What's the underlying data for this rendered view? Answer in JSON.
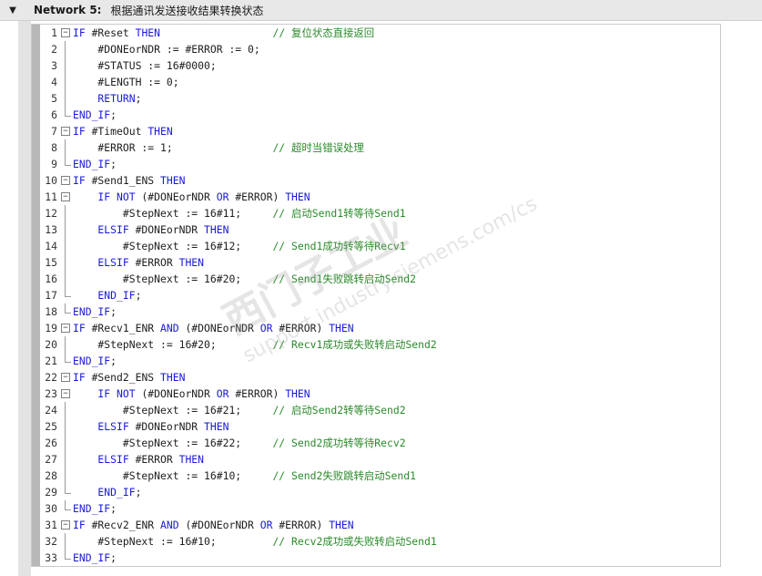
{
  "network": {
    "title": "Network 5:",
    "comment": "根据通讯发送接收结果转换状态",
    "toggle_icon": "▼"
  },
  "watermark": {
    "line1": "西门子工业",
    "line2": "support.industry.siemens.com/cs"
  },
  "code_lines": [
    {
      "n": "1",
      "fold": "open",
      "tokens": [
        [
          "kw",
          "IF "
        ],
        [
          "var",
          "#Reset "
        ],
        [
          "kw",
          "THEN"
        ],
        [
          "var",
          "                  "
        ],
        [
          "cm",
          "// 复位状态直接返回"
        ]
      ]
    },
    {
      "n": "2",
      "fold": "mid",
      "tokens": [
        [
          "var",
          "    #DONEorNDR := #ERROR := 0;"
        ]
      ]
    },
    {
      "n": "3",
      "fold": "mid",
      "tokens": [
        [
          "var",
          "    #STATUS := 16#0000;"
        ]
      ]
    },
    {
      "n": "4",
      "fold": "mid",
      "tokens": [
        [
          "var",
          "    #LENGTH := 0;"
        ]
      ]
    },
    {
      "n": "5",
      "fold": "mid",
      "tokens": [
        [
          "kw",
          "    RETURN"
        ],
        [
          "var",
          ";"
        ]
      ]
    },
    {
      "n": "6",
      "fold": "end",
      "tokens": [
        [
          "kw",
          "END_IF"
        ],
        [
          "var",
          ";"
        ]
      ]
    },
    {
      "n": "7",
      "fold": "open",
      "tokens": [
        [
          "kw",
          "IF "
        ],
        [
          "var",
          "#TimeOut "
        ],
        [
          "kw",
          "THEN"
        ]
      ]
    },
    {
      "n": "8",
      "fold": "mid",
      "tokens": [
        [
          "var",
          "    #ERROR := 1;                "
        ],
        [
          "cm",
          "// 超时当错误处理"
        ]
      ]
    },
    {
      "n": "9",
      "fold": "end",
      "tokens": [
        [
          "kw",
          "END_IF"
        ],
        [
          "var",
          ";"
        ]
      ]
    },
    {
      "n": "10",
      "fold": "open",
      "tokens": [
        [
          "kw",
          "IF "
        ],
        [
          "var",
          "#Send1_ENS "
        ],
        [
          "kw",
          "THEN"
        ]
      ]
    },
    {
      "n": "11",
      "fold": "open",
      "tokens": [
        [
          "kw",
          "    IF NOT "
        ],
        [
          "var",
          "(#DONEorNDR "
        ],
        [
          "kw",
          "OR "
        ],
        [
          "var",
          "#ERROR) "
        ],
        [
          "kw",
          "THEN"
        ]
      ]
    },
    {
      "n": "12",
      "fold": "mid",
      "tokens": [
        [
          "var",
          "        #StepNext := 16#11;     "
        ],
        [
          "cm",
          "// 启动Send1转等待Send1"
        ]
      ]
    },
    {
      "n": "13",
      "fold": "mid",
      "tokens": [
        [
          "kw",
          "    ELSIF "
        ],
        [
          "var",
          "#DONEorNDR "
        ],
        [
          "kw",
          "THEN"
        ]
      ]
    },
    {
      "n": "14",
      "fold": "mid",
      "tokens": [
        [
          "var",
          "        #StepNext := 16#12;     "
        ],
        [
          "cm",
          "// Send1成功转等待Recv1"
        ]
      ]
    },
    {
      "n": "15",
      "fold": "mid",
      "tokens": [
        [
          "kw",
          "    ELSIF "
        ],
        [
          "var",
          "#ERROR "
        ],
        [
          "kw",
          "THEN"
        ]
      ]
    },
    {
      "n": "16",
      "fold": "mid",
      "tokens": [
        [
          "var",
          "        #StepNext := 16#20;     "
        ],
        [
          "cm",
          "// Send1失败跳转启动Send2"
        ]
      ]
    },
    {
      "n": "17",
      "fold": "end",
      "tokens": [
        [
          "kw",
          "    END_IF"
        ],
        [
          "var",
          ";"
        ]
      ]
    },
    {
      "n": "18",
      "fold": "end",
      "tokens": [
        [
          "kw",
          "END_IF"
        ],
        [
          "var",
          ";"
        ]
      ]
    },
    {
      "n": "19",
      "fold": "open",
      "tokens": [
        [
          "kw",
          "IF "
        ],
        [
          "var",
          "#Recv1_ENR "
        ],
        [
          "kw",
          "AND "
        ],
        [
          "var",
          "(#DONEorNDR "
        ],
        [
          "kw",
          "OR "
        ],
        [
          "var",
          "#ERROR) "
        ],
        [
          "kw",
          "THEN"
        ]
      ]
    },
    {
      "n": "20",
      "fold": "mid",
      "tokens": [
        [
          "var",
          "    #StepNext := 16#20;         "
        ],
        [
          "cm",
          "// Recv1成功或失败转启动Send2"
        ]
      ]
    },
    {
      "n": "21",
      "fold": "end",
      "tokens": [
        [
          "kw",
          "END_IF"
        ],
        [
          "var",
          ";"
        ]
      ]
    },
    {
      "n": "22",
      "fold": "open",
      "tokens": [
        [
          "kw",
          "IF "
        ],
        [
          "var",
          "#Send2_ENS "
        ],
        [
          "kw",
          "THEN"
        ]
      ]
    },
    {
      "n": "23",
      "fold": "open",
      "tokens": [
        [
          "kw",
          "    IF NOT "
        ],
        [
          "var",
          "(#DONEorNDR "
        ],
        [
          "kw",
          "OR "
        ],
        [
          "var",
          "#ERROR) "
        ],
        [
          "kw",
          "THEN"
        ]
      ]
    },
    {
      "n": "24",
      "fold": "mid",
      "tokens": [
        [
          "var",
          "        #StepNext := 16#21;     "
        ],
        [
          "cm",
          "// 启动Send2转等待Send2"
        ]
      ]
    },
    {
      "n": "25",
      "fold": "mid",
      "tokens": [
        [
          "kw",
          "    ELSIF "
        ],
        [
          "var",
          "#DONEorNDR "
        ],
        [
          "kw",
          "THEN"
        ]
      ]
    },
    {
      "n": "26",
      "fold": "mid",
      "tokens": [
        [
          "var",
          "        #StepNext := 16#22;     "
        ],
        [
          "cm",
          "// Send2成功转等待Recv2"
        ]
      ]
    },
    {
      "n": "27",
      "fold": "mid",
      "tokens": [
        [
          "kw",
          "    ELSIF "
        ],
        [
          "var",
          "#ERROR "
        ],
        [
          "kw",
          "THEN"
        ]
      ]
    },
    {
      "n": "28",
      "fold": "mid",
      "tokens": [
        [
          "var",
          "        #StepNext := 16#10;     "
        ],
        [
          "cm",
          "// Send2失败跳转启动Send1"
        ]
      ]
    },
    {
      "n": "29",
      "fold": "end",
      "tokens": [
        [
          "kw",
          "    END_IF"
        ],
        [
          "var",
          ";"
        ]
      ]
    },
    {
      "n": "30",
      "fold": "end",
      "tokens": [
        [
          "kw",
          "END_IF"
        ],
        [
          "var",
          ";"
        ]
      ]
    },
    {
      "n": "31",
      "fold": "open",
      "tokens": [
        [
          "kw",
          "IF "
        ],
        [
          "var",
          "#Recv2_ENR "
        ],
        [
          "kw",
          "AND "
        ],
        [
          "var",
          "(#DONEorNDR "
        ],
        [
          "kw",
          "OR "
        ],
        [
          "var",
          "#ERROR) "
        ],
        [
          "kw",
          "THEN"
        ]
      ]
    },
    {
      "n": "32",
      "fold": "mid",
      "tokens": [
        [
          "var",
          "    #StepNext := 16#10;         "
        ],
        [
          "cm",
          "// Recv2成功或失败转启动Send1"
        ]
      ]
    },
    {
      "n": "33",
      "fold": "end",
      "tokens": [
        [
          "kw",
          "END_IF"
        ],
        [
          "var",
          ";"
        ]
      ]
    }
  ]
}
